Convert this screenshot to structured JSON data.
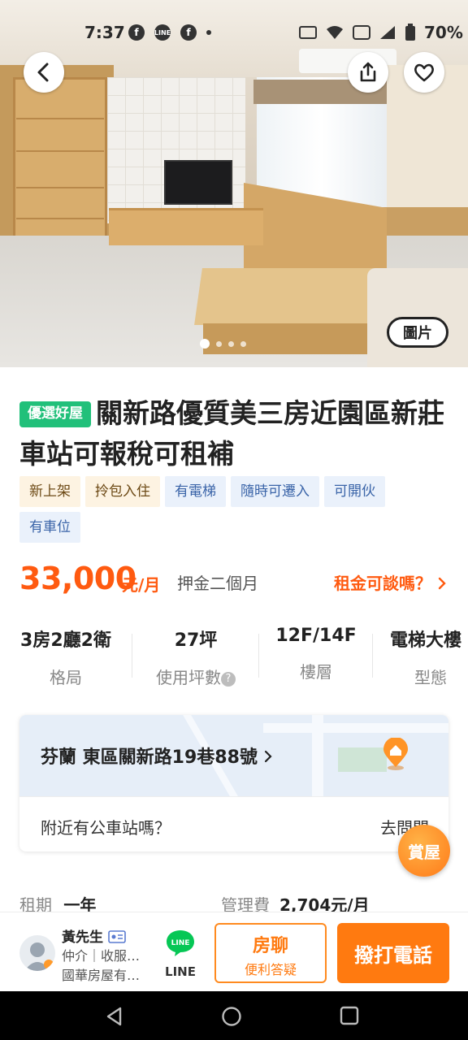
{
  "status_bar": {
    "time": "7:37",
    "battery": "70%"
  },
  "hero": {
    "photo_button": "圖片",
    "photo_count": 4,
    "active_photo": 1
  },
  "listing": {
    "badge": "優選好屋",
    "title": "關新路優質美三房近園區新莊車站可報稅可租補",
    "tags": [
      {
        "label": "新上架",
        "style": "warm"
      },
      {
        "label": "拎包入住",
        "style": "warm"
      },
      {
        "label": "有電梯",
        "style": "blue"
      },
      {
        "label": "隨時可遷入",
        "style": "blue"
      },
      {
        "label": "可開伙",
        "style": "blue"
      },
      {
        "label": "有車位",
        "style": "blue"
      }
    ],
    "price": "33,000",
    "price_unit": "元/月",
    "deposit": "押金二個月",
    "negotiate": "租金可談嗎？",
    "specs": [
      {
        "value": "3房2廳2衛",
        "label": "格局"
      },
      {
        "value": "27坪",
        "label": "使用坪數"
      },
      {
        "value": "12F/14F",
        "label": "樓層"
      },
      {
        "value": "電梯大樓",
        "label": "型態"
      }
    ],
    "address": "芬蘭 東區關新路19巷88號",
    "bus_question": "附近有公車站嗎？",
    "bus_ask": "去問問",
    "lease_label": "租期",
    "lease_value": "一年",
    "mgmt_label": "管理費",
    "mgmt_value": "2,704元/月"
  },
  "fab_label": "賞屋",
  "agent": {
    "name": "黃先生",
    "role": "仲介｜收服…",
    "company": "國華房屋有…"
  },
  "bottom_actions": {
    "line_label": "LINE",
    "chat_title": "房聊",
    "chat_sub": "便利答疑",
    "call_label": "撥打電話"
  },
  "colors": {
    "accent": "#ff7a10",
    "price": "#ff5a10",
    "badge_green": "#21c07a",
    "tag_blue_text": "#3a64a8"
  }
}
